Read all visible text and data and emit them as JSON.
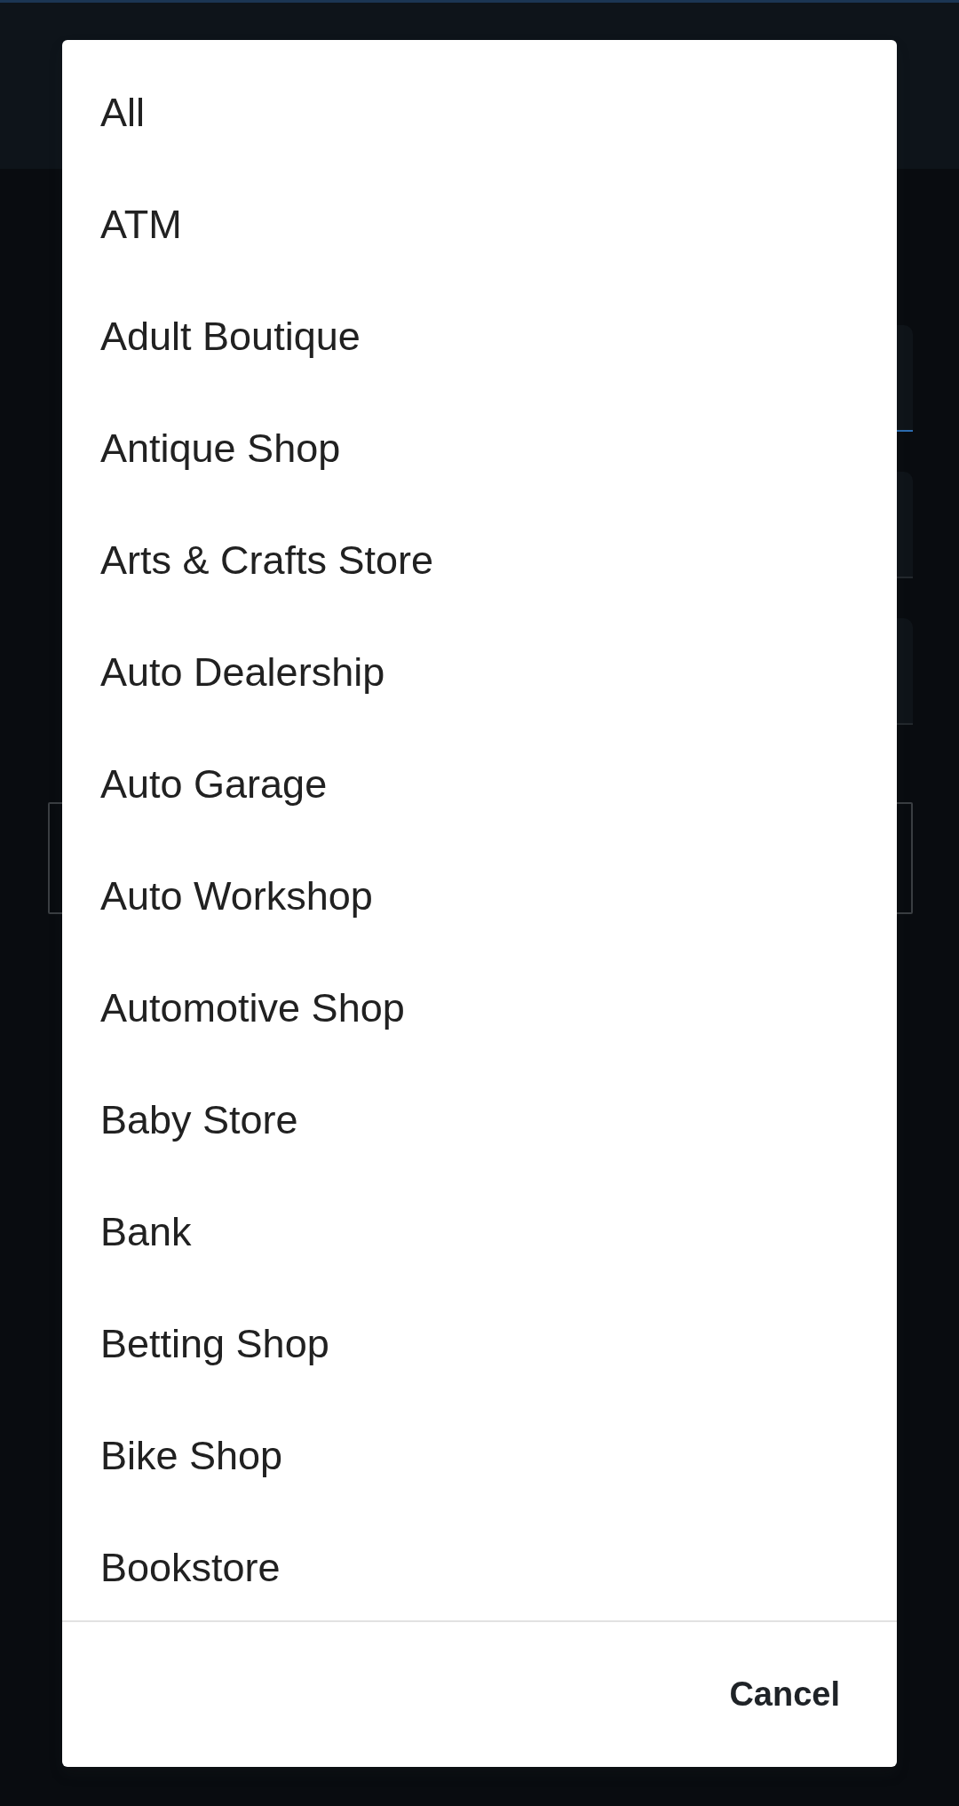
{
  "background_form": {
    "fields": [
      {
        "focused": true
      },
      {
        "focused": false
      },
      {
        "focused": false
      }
    ]
  },
  "dialog": {
    "options": [
      "All",
      "ATM",
      "Adult Boutique",
      "Antique Shop",
      "Arts & Crafts Store",
      "Auto Dealership",
      "Auto Garage",
      "Auto Workshop",
      "Automotive Shop",
      "Baby Store",
      "Bank",
      "Betting Shop",
      "Bike Shop",
      "Bookstore"
    ],
    "buttons": [
      "Cancel"
    ]
  }
}
